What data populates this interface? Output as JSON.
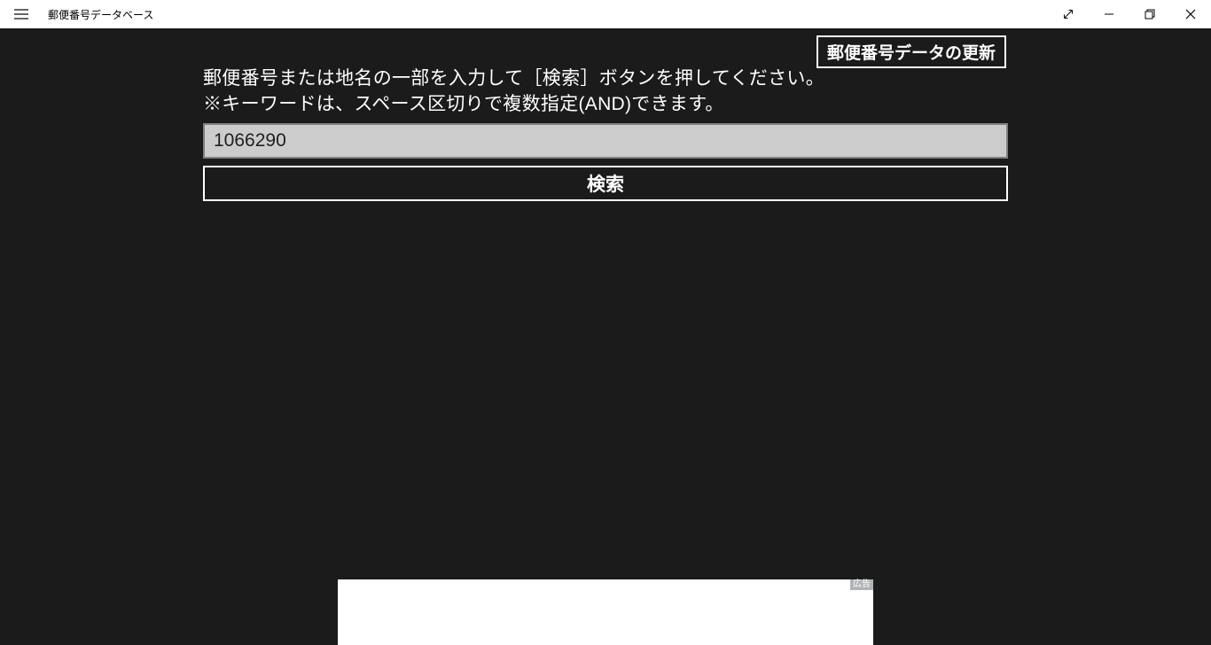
{
  "titlebar": {
    "app_title": "郵便番号データベース"
  },
  "update_button": {
    "label": "郵便番号データの更新"
  },
  "instructions": {
    "line1": "郵便番号または地名の一部を入力して［検索］ボタンを押してください。",
    "line2": "※キーワードは、スペース区切りで複数指定(AND)できます。"
  },
  "search": {
    "value": "1066290",
    "button_label": "検索"
  },
  "ad": {
    "badge": "広告"
  }
}
